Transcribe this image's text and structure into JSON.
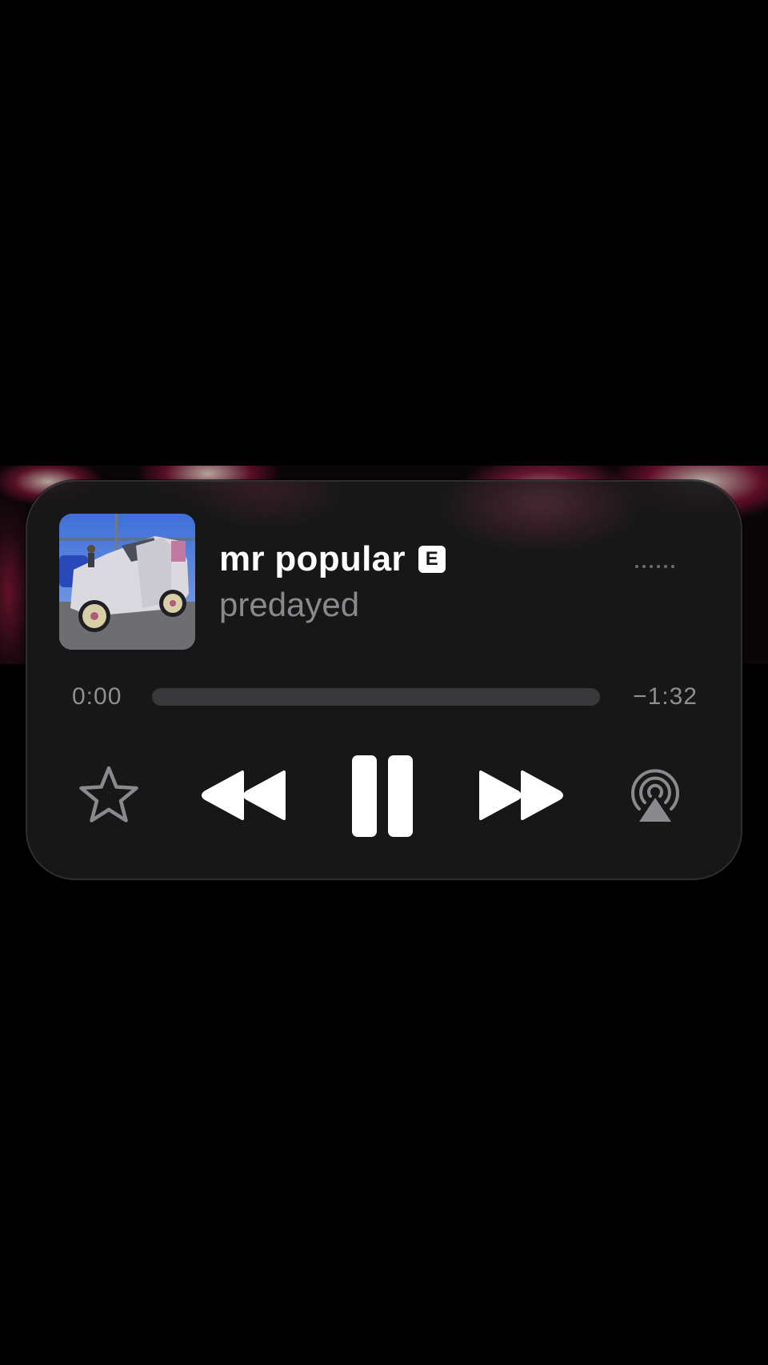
{
  "now_playing": {
    "title": "mr popular",
    "explicit_badge": "E",
    "artist": "predayed",
    "artwork": "album-artwork"
  },
  "progress": {
    "elapsed": "0:00",
    "remaining": "−1:32",
    "fraction": 0.0
  },
  "controls": {
    "favorite": "star-icon",
    "previous": "rewind-icon",
    "play_pause": "pause-icon",
    "next": "fast-forward-icon",
    "output": "airplay-audio-icon",
    "more": "more-options-icon"
  },
  "colors": {
    "background": "#000000",
    "card": "#18181a",
    "primary_text": "#ffffff",
    "secondary_text": "#8a8a8e",
    "track": "#38383b"
  }
}
